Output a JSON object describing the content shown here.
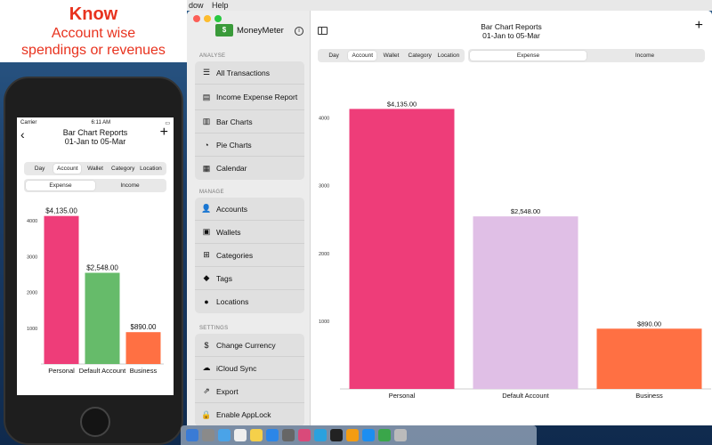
{
  "promo": {
    "line1": "Know",
    "line2": "Account wise",
    "line3": "spendings or revenues"
  },
  "menubar": {
    "item1": "dow",
    "item2": "Help"
  },
  "phone": {
    "carrier": "Carrier",
    "time": "6:11 AM",
    "title": "Bar Chart Reports",
    "subtitle": "01-Jan to 05-Mar",
    "back_icon": "chevron-left-icon",
    "add_icon": "plus-icon",
    "tabs": [
      "Day",
      "Account",
      "Wallet",
      "Category",
      "Location"
    ],
    "active_tab": "Account",
    "type_tabs": [
      "Expense",
      "Income"
    ],
    "active_type": "Expense"
  },
  "window": {
    "app_name": "MoneyMeter",
    "title": "Bar Chart Reports",
    "subtitle": "01-Jan to 05-Mar",
    "tabs": [
      "Day",
      "Account",
      "Wallet",
      "Category",
      "Location"
    ],
    "active_tab": "Account",
    "type_tabs": [
      "Expense",
      "Income"
    ],
    "active_type": "Expense"
  },
  "sidebar": {
    "analyse_header": "ANALYSE",
    "analyse": [
      {
        "label": "All Transactions",
        "icon": "list-icon"
      },
      {
        "label": "Income Expense Report",
        "icon": "report-icon"
      },
      {
        "label": "Bar Charts",
        "icon": "bar-chart-icon"
      },
      {
        "label": "Pie Charts",
        "icon": "pie-chart-icon"
      },
      {
        "label": "Calendar",
        "icon": "calendar-icon"
      }
    ],
    "manage_header": "MANAGE",
    "manage": [
      {
        "label": "Accounts",
        "icon": "accounts-icon"
      },
      {
        "label": "Wallets",
        "icon": "wallet-icon"
      },
      {
        "label": "Categories",
        "icon": "categories-icon"
      },
      {
        "label": "Tags",
        "icon": "tag-icon"
      },
      {
        "label": "Locations",
        "icon": "location-pin-icon"
      }
    ],
    "settings_header": "SETTINGS",
    "settings": [
      {
        "label": "Change Currency",
        "icon": "currency-icon"
      },
      {
        "label": "iCloud Sync",
        "icon": "cloud-sync-icon"
      },
      {
        "label": "Export",
        "icon": "export-icon"
      },
      {
        "label": "Enable AppLock",
        "icon": "lock-icon"
      }
    ]
  },
  "colors": {
    "personal": "#ee3d79",
    "default_account": "#e0bfe6",
    "business": "#ff7043",
    "phone_default_account": "#66bb6a"
  },
  "chart_data": [
    {
      "type": "bar",
      "categories": [
        "Personal",
        "Default Account",
        "Business"
      ],
      "values": [
        4135,
        2548,
        890
      ],
      "labels": [
        "$4,135.00",
        "$2,548.00",
        "$890.00"
      ],
      "yticks": [
        1000,
        2000,
        3000,
        4000
      ],
      "ylim": [
        0,
        4500
      ]
    },
    {
      "type": "bar",
      "categories": [
        "Personal",
        "Default Account",
        "Business"
      ],
      "values": [
        4135,
        2548,
        890
      ],
      "labels": [
        "$4,135.00",
        "$2,548.00",
        "$890.00"
      ],
      "yticks": [
        1000,
        2000,
        3000,
        4000
      ],
      "ylim": [
        0,
        4600
      ]
    }
  ]
}
